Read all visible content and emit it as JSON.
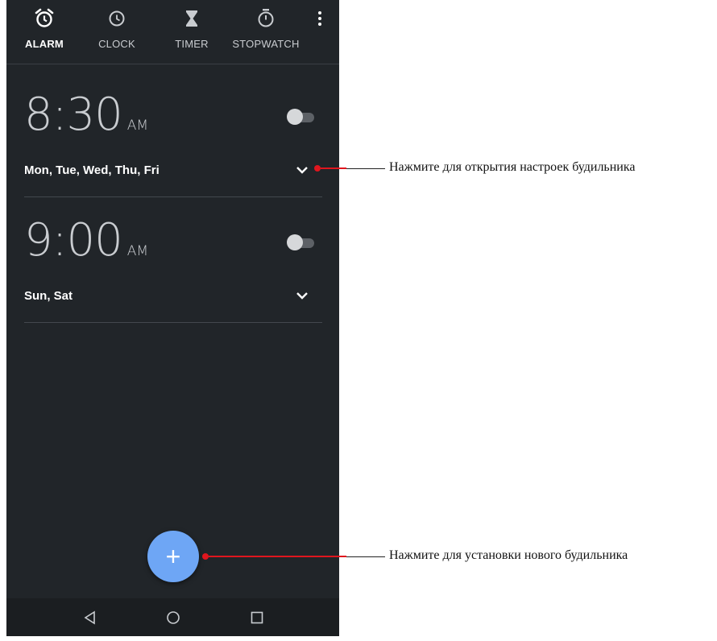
{
  "tabs": [
    {
      "label": "ALARM",
      "icon": "alarm-icon",
      "active": true
    },
    {
      "label": "CLOCK",
      "icon": "clock-icon",
      "active": false
    },
    {
      "label": "TIMER",
      "icon": "hourglass-icon",
      "active": false
    },
    {
      "label": "STOPWATCH",
      "icon": "stopwatch-icon",
      "active": false
    }
  ],
  "alarms": [
    {
      "time": "8:30",
      "ampm": "AM",
      "days": "Mon, Tue, Wed, Thu, Fri",
      "enabled": false
    },
    {
      "time": "9:00",
      "ampm": "AM",
      "days": "Sun, Sat",
      "enabled": false
    }
  ],
  "fab": {
    "label": "+"
  },
  "callouts": [
    {
      "text": "Нажмите для открытия настроек будильника"
    },
    {
      "text": "Нажмите для установки нового будильника"
    }
  ],
  "colors": {
    "background": "#212529",
    "accent": "#6ea6f5",
    "callout": "#e0161e"
  }
}
